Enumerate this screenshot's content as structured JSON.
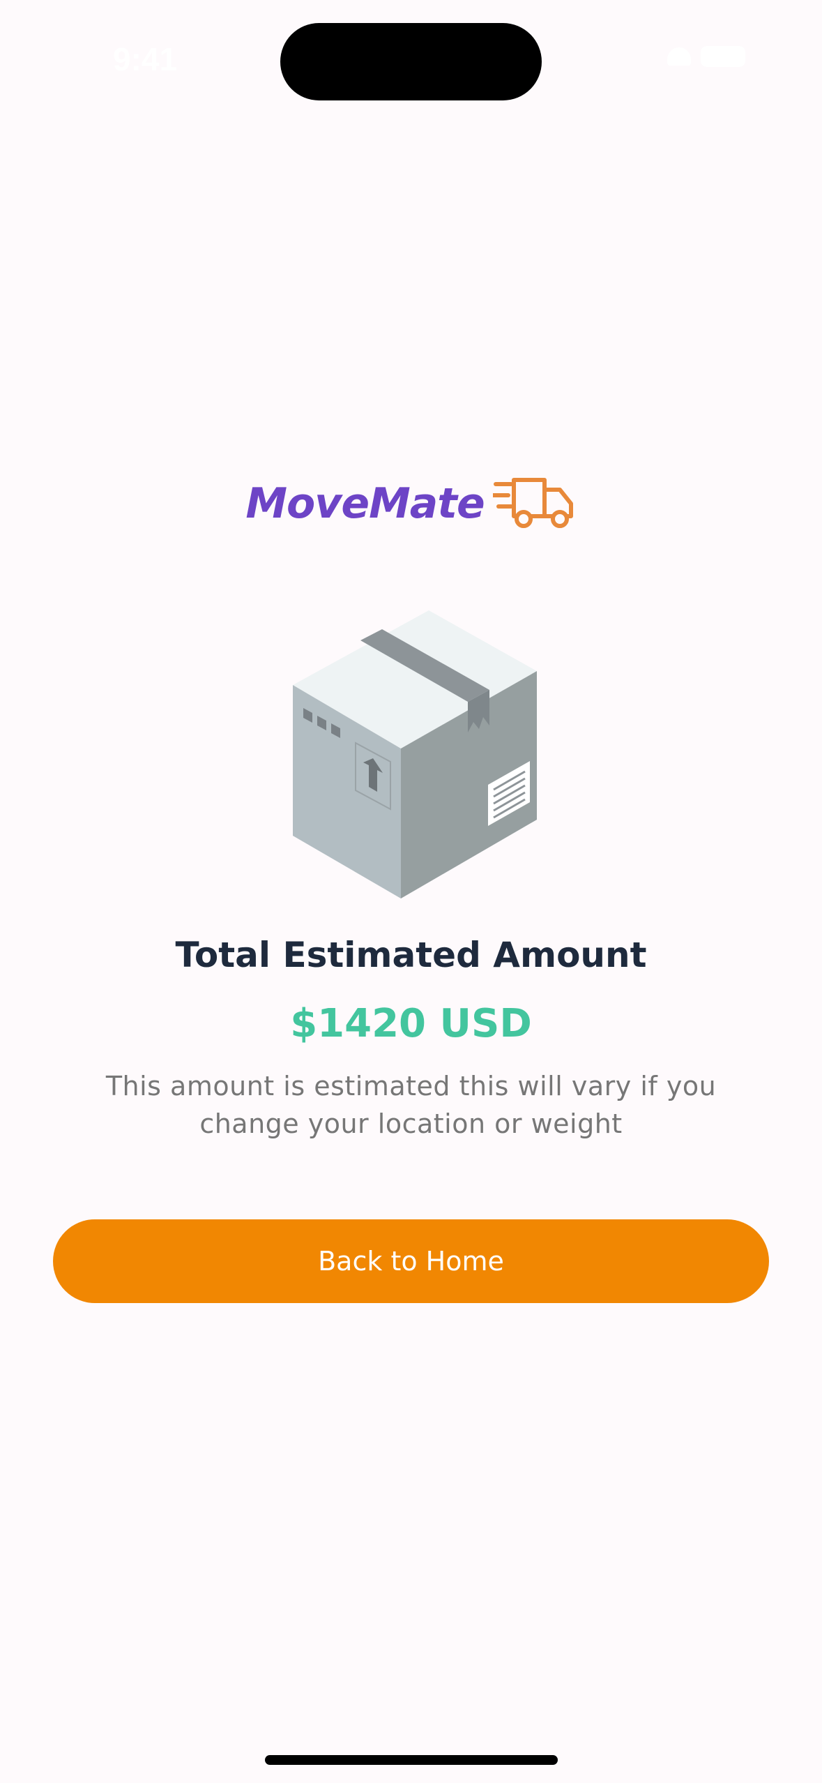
{
  "status_bar": {
    "time": "9:41"
  },
  "logo": {
    "text": "MoveMate",
    "icon": "delivery-truck-icon"
  },
  "illustration": {
    "icon": "cardboard-box-illustration"
  },
  "estimate": {
    "title": "Total Estimated Amount",
    "amount": "$1420 USD",
    "note": "This amount is estimated this will vary if you change your location or weight"
  },
  "actions": {
    "back_home_label": "Back to Home"
  },
  "colors": {
    "brand_purple": "#6d44c6",
    "accent_orange": "#f18702",
    "amount_green": "#43c59e",
    "title_dark": "#1e2a3d",
    "background": "#fefafc"
  }
}
